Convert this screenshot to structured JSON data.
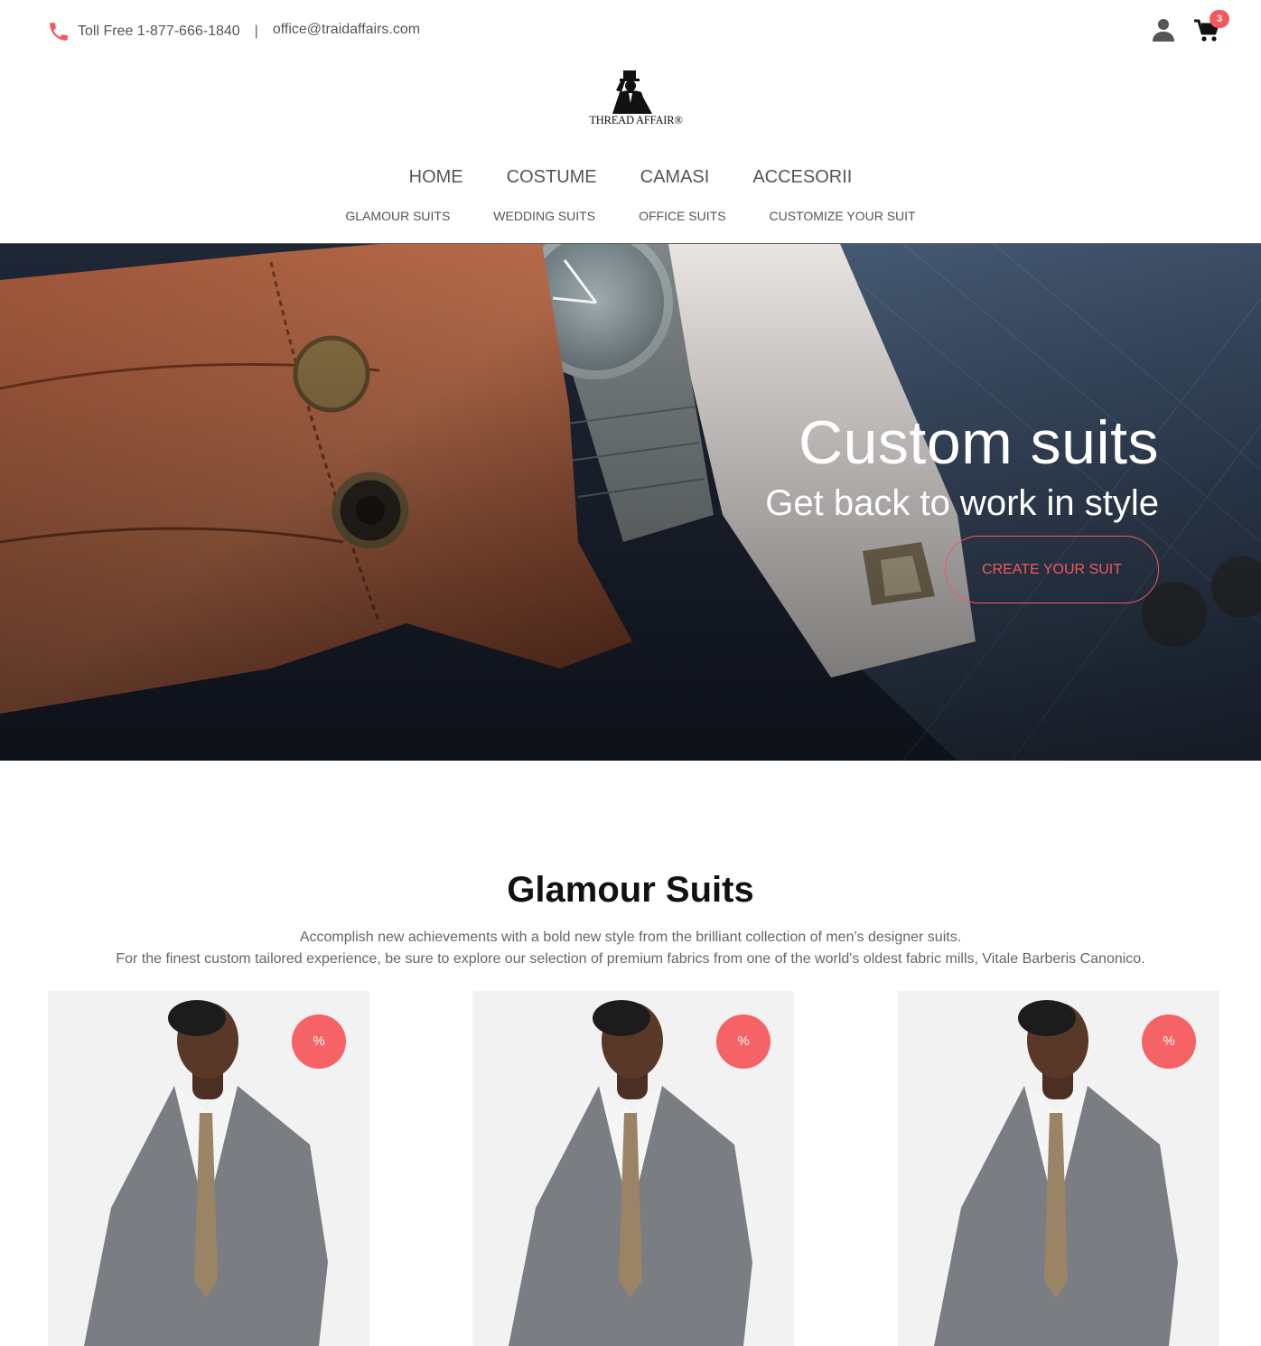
{
  "topbar": {
    "phone_label": "Toll Free 1-877-666-1840",
    "separator": "|",
    "email": "office@traidaffairs.com",
    "cart_count": "3"
  },
  "logo": {
    "text": "THREAD AFFAIR®"
  },
  "nav": {
    "main": [
      "HOME",
      "COSTUME",
      "CAMASI",
      "ACCESORII"
    ],
    "sub": [
      "GLAMOUR SUITS",
      "WEDDING SUITS",
      "OFFICE SUITS",
      "CUSTOMIZE YOUR SUIT"
    ]
  },
  "hero": {
    "title": "Custom suits",
    "subtitle": "Get back to work in style",
    "cta": "CREATE YOUR SUIT"
  },
  "section": {
    "title_light": "Glamour ",
    "title_bold": "Suits",
    "desc_line1": "Accomplish new achievements with a bold new style from the brilliant collection of men's designer suits.",
    "desc_line2": "For the finest custom tailored experience, be sure to explore our selection of premium fabrics from one of the world's oldest fabric mills, Vitale Barberis Canonico."
  },
  "products": [
    {
      "badge": "%"
    },
    {
      "badge": "%"
    },
    {
      "badge": "%"
    }
  ],
  "colors": {
    "accent": "#f2585d",
    "text": "#555555"
  },
  "icons": [
    "phone-icon",
    "user-icon",
    "cart-icon"
  ]
}
